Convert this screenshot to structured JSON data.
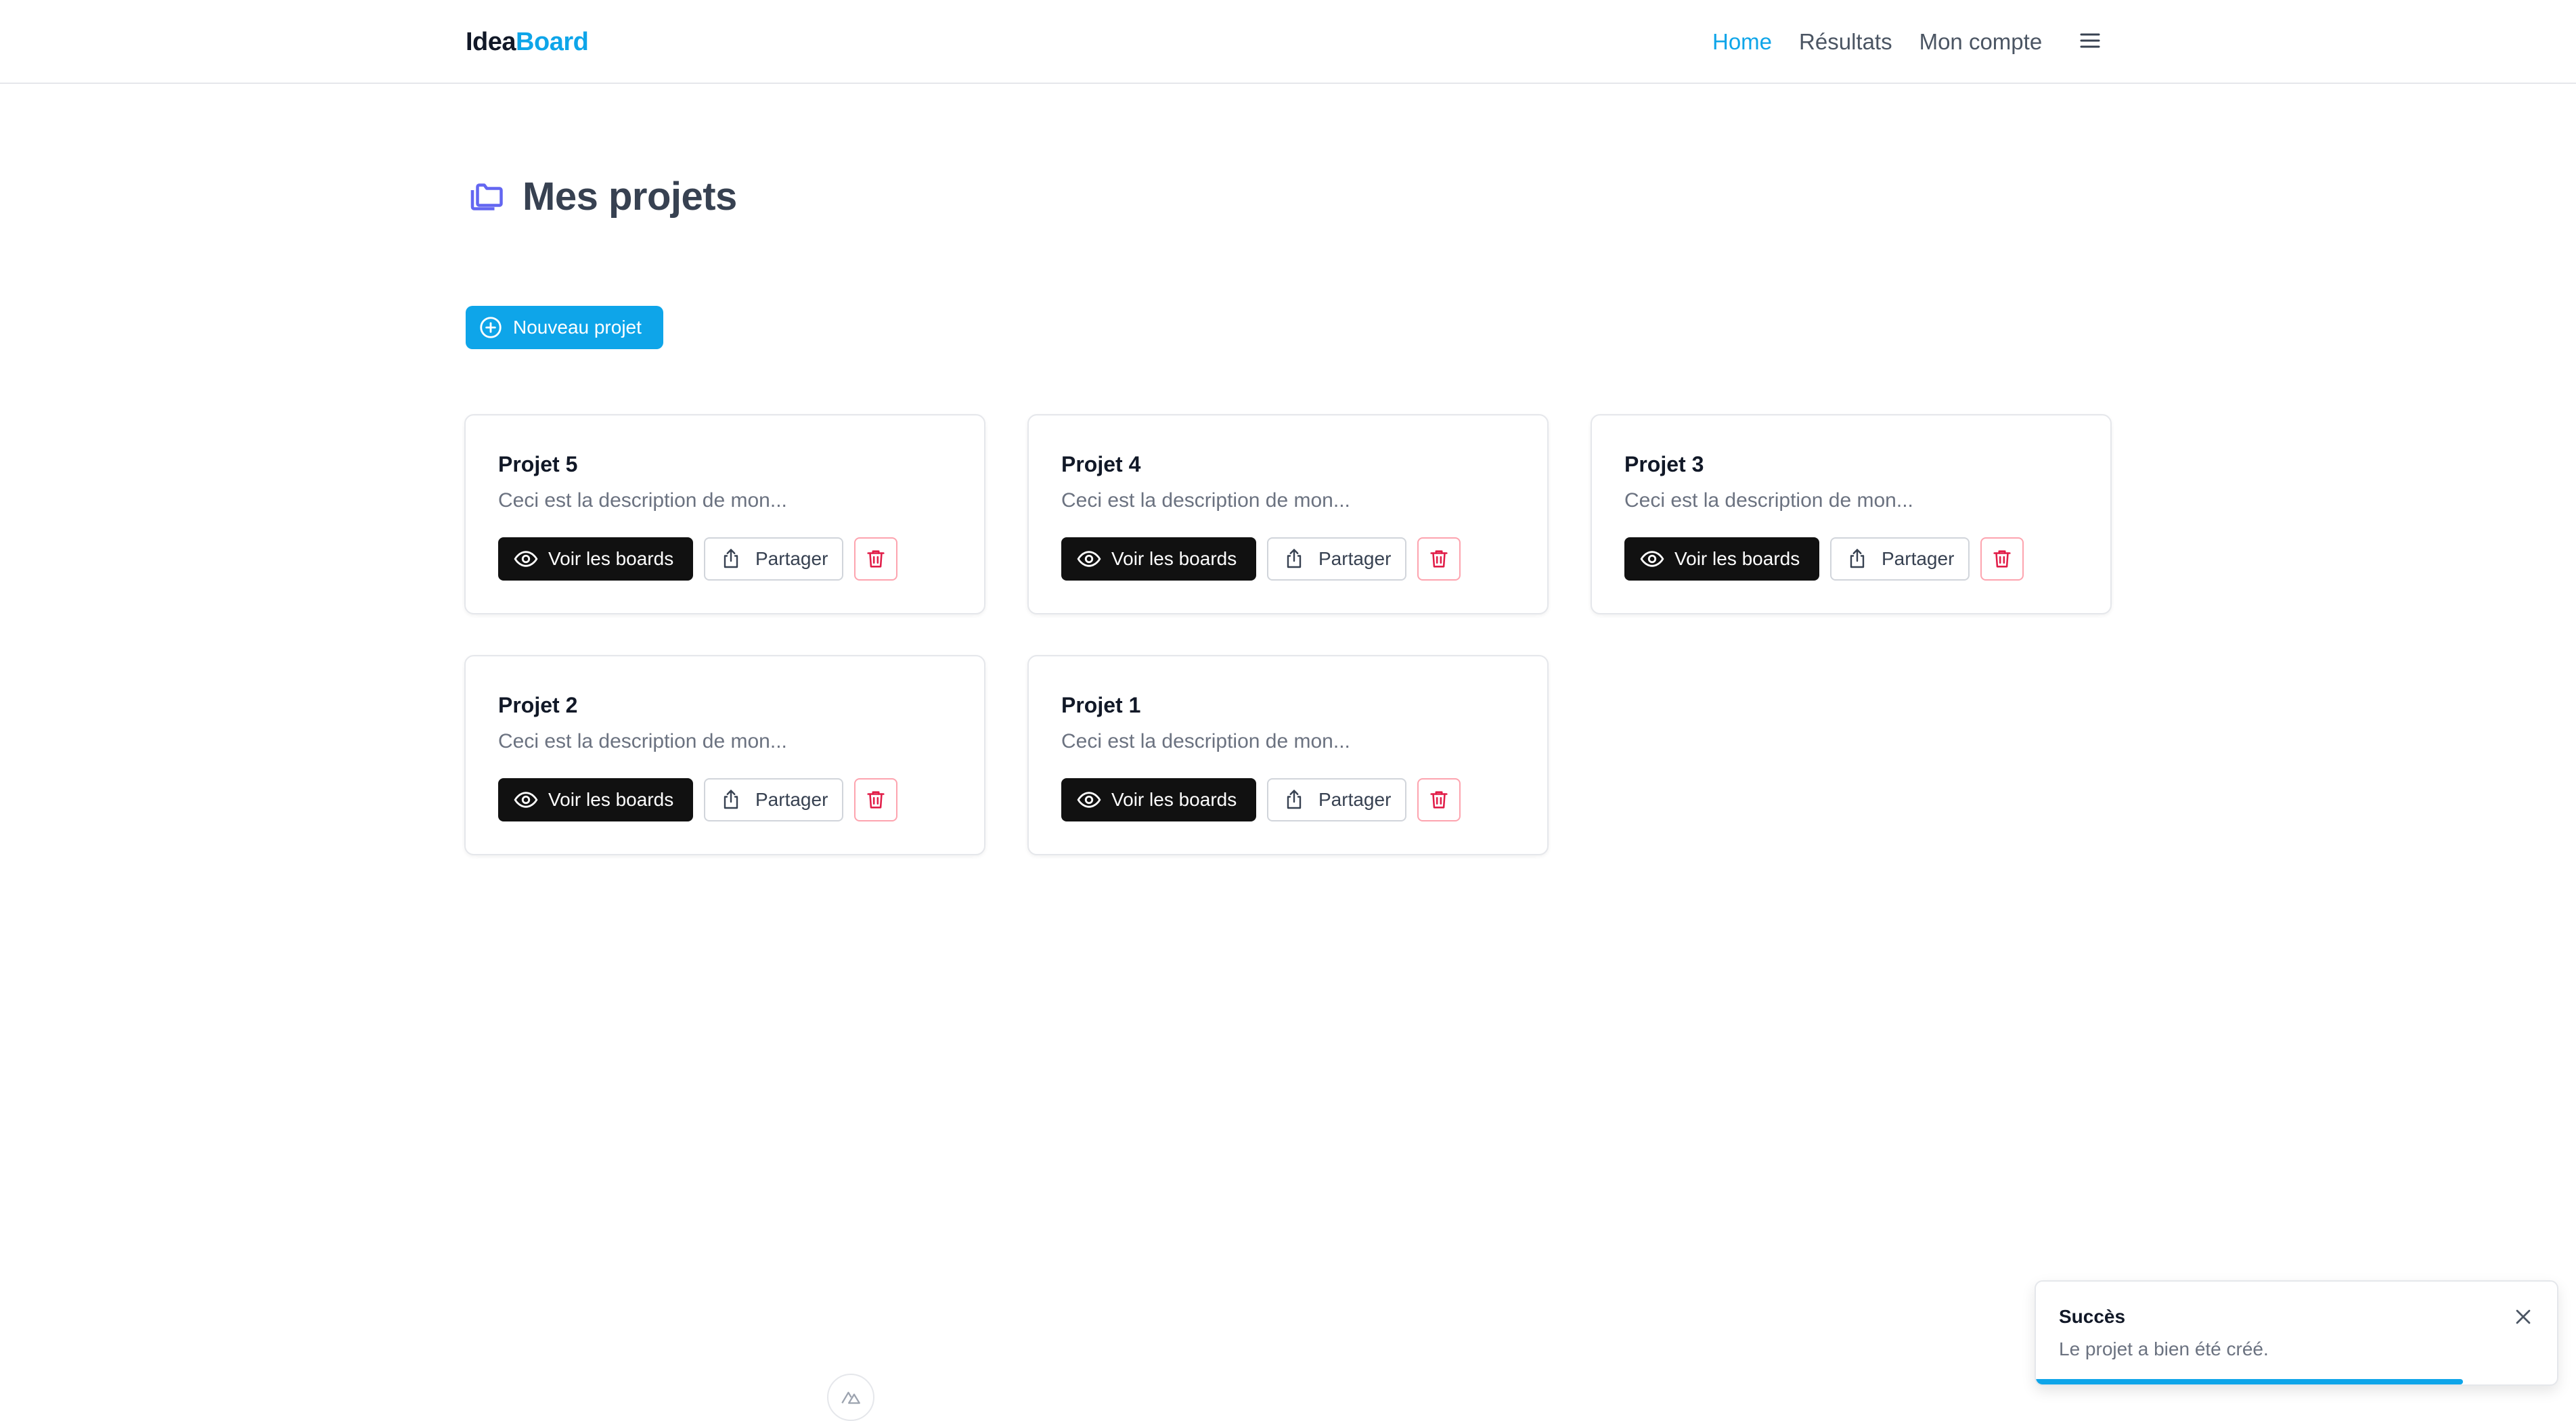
{
  "header": {
    "logo_part1": "Idea",
    "logo_part2": "Board",
    "nav": [
      {
        "label": "Home",
        "active": true
      },
      {
        "label": "Résultats",
        "active": false
      },
      {
        "label": "Mon compte",
        "active": false
      }
    ],
    "menu_icon": "hamburger-menu-icon"
  },
  "main": {
    "title": "Mes projets",
    "title_icon": "folders-icon",
    "new_project_label": "Nouveau projet",
    "projects": [
      {
        "name": "Projet 5",
        "description": "Ceci est la description de mon...",
        "view_label": "Voir les boards",
        "share_label": "Partager"
      },
      {
        "name": "Projet 4",
        "description": "Ceci est la description de mon...",
        "view_label": "Voir les boards",
        "share_label": "Partager"
      },
      {
        "name": "Projet 3",
        "description": "Ceci est la description de mon...",
        "view_label": "Voir les boards",
        "share_label": "Partager"
      },
      {
        "name": "Projet 2",
        "description": "Ceci est la description de mon...",
        "view_label": "Voir les boards",
        "share_label": "Partager"
      },
      {
        "name": "Projet 1",
        "description": "Ceci est la description de mon...",
        "view_label": "Voir les boards",
        "share_label": "Partager"
      }
    ]
  },
  "toast": {
    "title": "Succès",
    "message": "Le projet a bien été créé.",
    "progress": 0.82
  },
  "colors": {
    "accent": "#0ea5e9",
    "dark_button": "#111111",
    "danger": "#e11d48",
    "icon_purple": "#6366f1"
  }
}
